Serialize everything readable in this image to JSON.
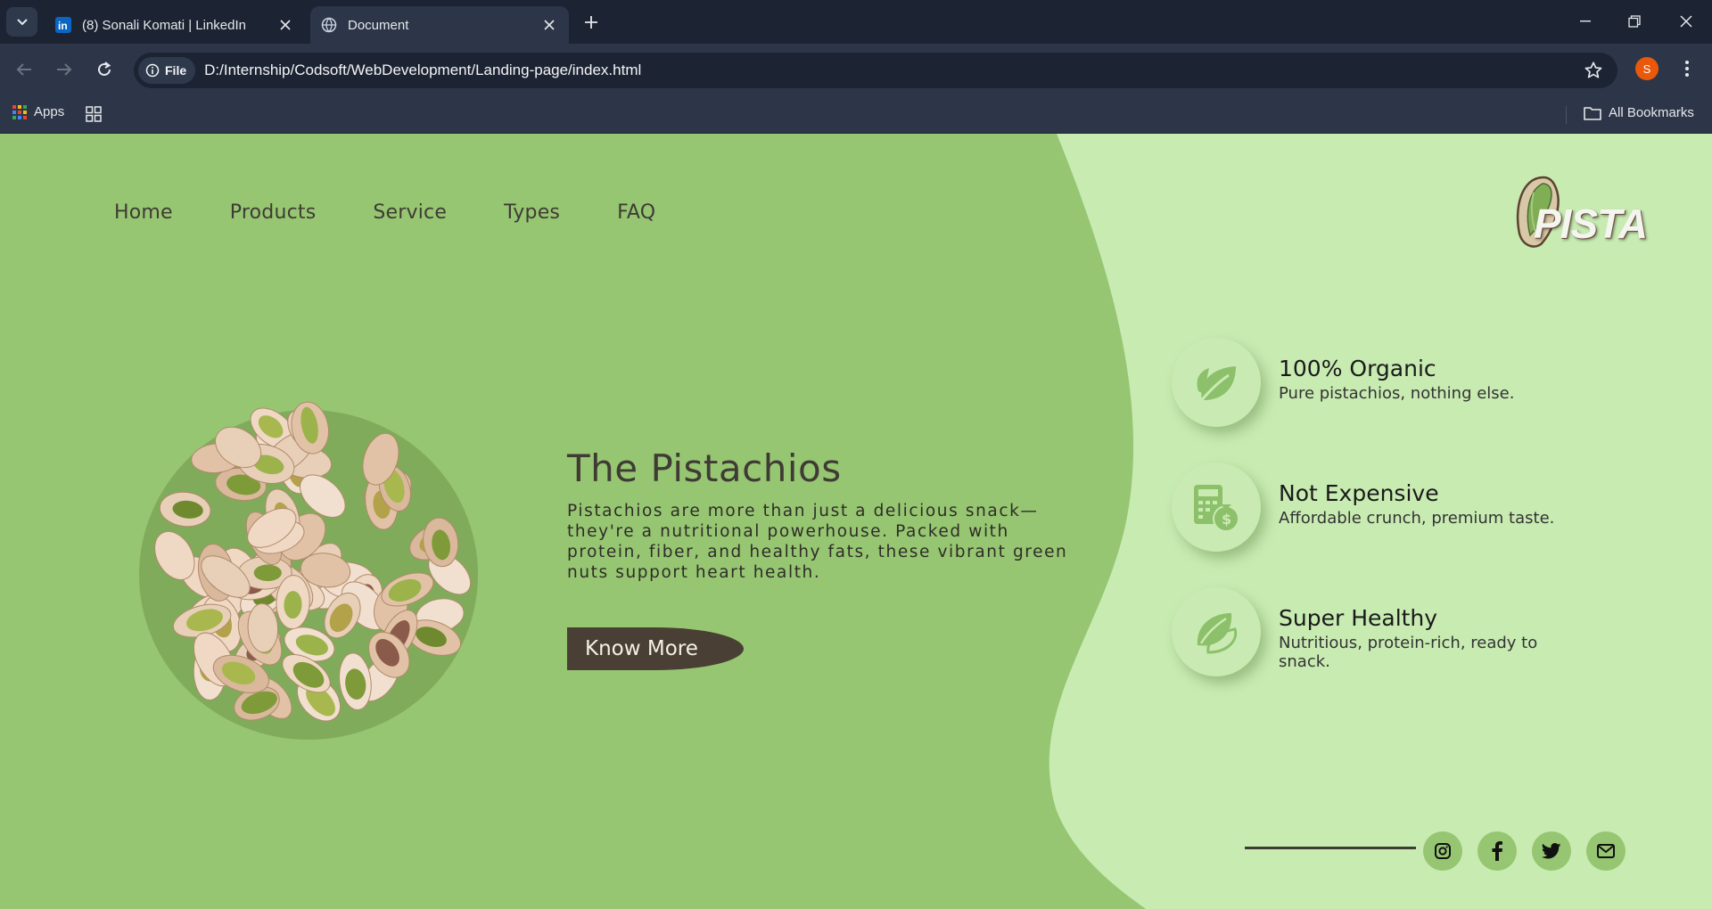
{
  "browser": {
    "tabs": [
      {
        "title": "(8) Sonali Komati | LinkedIn",
        "favicon": "linkedin-icon",
        "active": false
      },
      {
        "title": "Document",
        "favicon": "globe-icon",
        "active": true
      }
    ],
    "address": {
      "chip_label": "File",
      "url": "D:/Internship/Codsoft/WebDevelopment/Landing-page/index.html"
    },
    "profile_initial": "S",
    "bookmarks": {
      "apps_label": "Apps",
      "all_bookmarks_label": "All Bookmarks"
    }
  },
  "page": {
    "colors": {
      "primary_green": "#96c672",
      "light_green": "#c8ebb2",
      "dark_brown": "#4a3f35"
    },
    "nav": [
      "Home",
      "Products",
      "Service",
      "Types",
      "FAQ"
    ],
    "logo_text": "PISTA",
    "hero": {
      "title": "The Pistachios",
      "text": "Pistachios are more than just a delicious snack—they're a nutritional powerhouse. Packed with protein, fiber, and healthy fats, these vibrant green nuts support heart health.",
      "button": "Know More"
    },
    "features": [
      {
        "title": "100% Organic",
        "desc": "Pure pistachios, nothing else.",
        "icon": "leaf-icon"
      },
      {
        "title": "Not Expensive",
        "desc": "Affordable crunch, premium taste.",
        "icon": "money-bag-icon"
      },
      {
        "title": "Super Healthy",
        "desc": "Nutritious, protein-rich, ready to snack.",
        "icon": "pistachio-icon"
      }
    ],
    "social": [
      "instagram-icon",
      "facebook-icon",
      "twitter-icon",
      "mail-icon"
    ]
  }
}
